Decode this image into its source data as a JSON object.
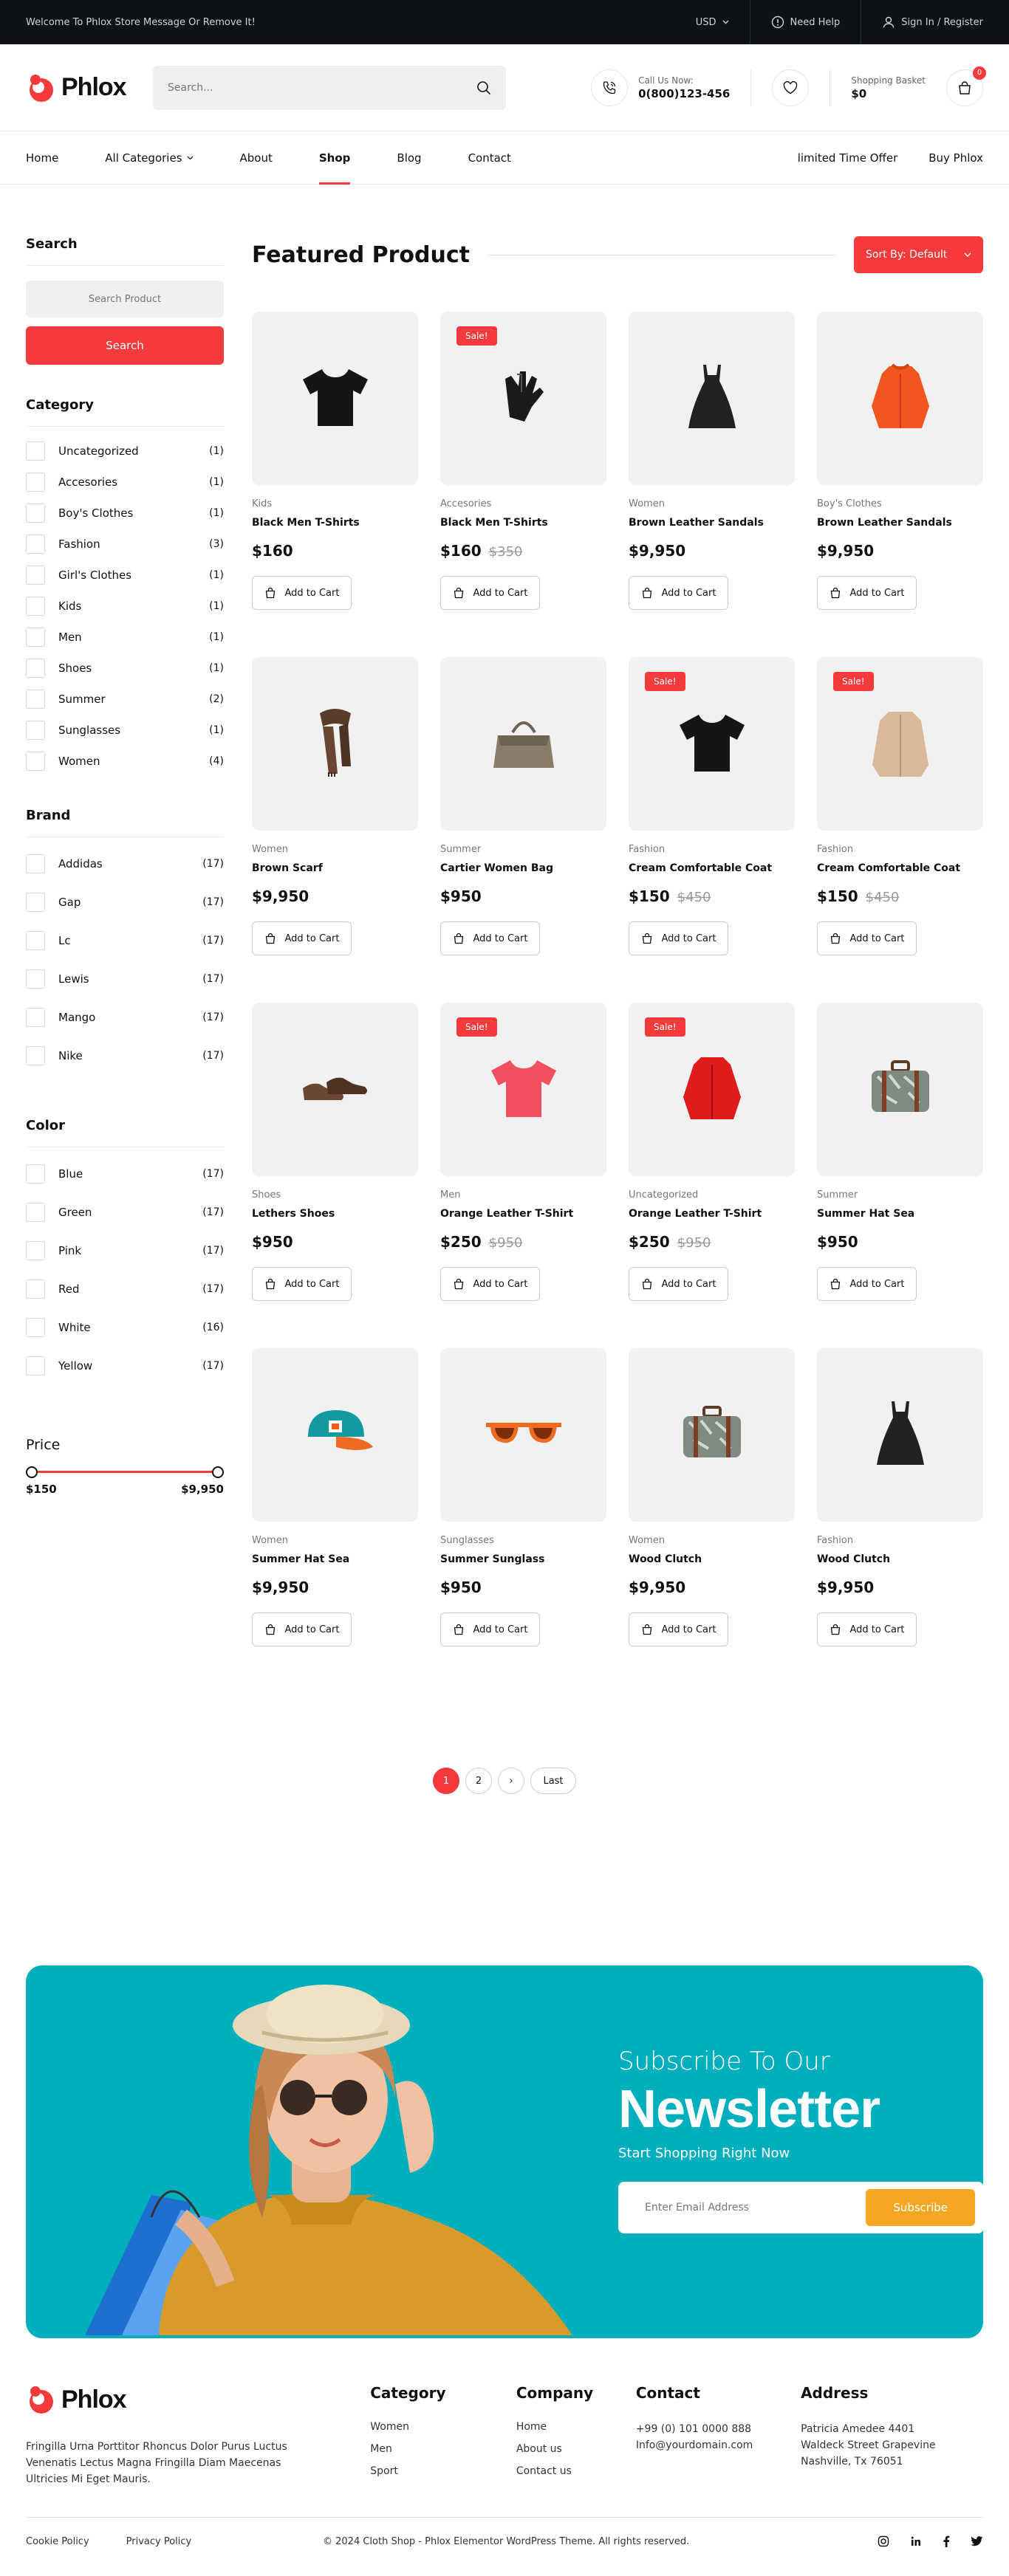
{
  "topbar": {
    "message": "Welcome To Phlox Store Message Or Remove It!",
    "currency": "USD",
    "help": "Need Help",
    "account": "Sign In / Register"
  },
  "header": {
    "logo": "Phlox",
    "search_placeholder": "Search...",
    "call_label": "Call Us Now:",
    "call_number": "0(800)123-456",
    "cart_label": "Shopping Basket",
    "cart_amount": "$0",
    "cart_count": "0"
  },
  "nav": {
    "items": [
      "Home",
      "All Categories",
      "About",
      "Shop",
      "Blog",
      "Contact"
    ],
    "right": [
      "limited Time Offer",
      "Buy Phlox"
    ]
  },
  "sidebar": {
    "search_title": "Search",
    "search_placeholder": "Search Product",
    "search_button": "Search",
    "category_title": "Category",
    "categories": [
      {
        "name": "Uncategorized",
        "count": "(1)"
      },
      {
        "name": "Accesories",
        "count": "(1)"
      },
      {
        "name": "Boy's Clothes",
        "count": "(1)"
      },
      {
        "name": "Fashion",
        "count": "(3)"
      },
      {
        "name": "Girl's Clothes",
        "count": "(1)"
      },
      {
        "name": "Kids",
        "count": "(1)"
      },
      {
        "name": "Men",
        "count": "(1)"
      },
      {
        "name": "Shoes",
        "count": "(1)"
      },
      {
        "name": "Summer",
        "count": "(2)"
      },
      {
        "name": "Sunglasses",
        "count": "(1)"
      },
      {
        "name": "Women",
        "count": "(4)"
      }
    ],
    "brand_title": "Brand",
    "brands": [
      {
        "name": "Addidas",
        "count": "(17)"
      },
      {
        "name": "Gap",
        "count": "(17)"
      },
      {
        "name": "Lc",
        "count": "(17)"
      },
      {
        "name": "Lewis",
        "count": "(17)"
      },
      {
        "name": "Mango",
        "count": "(17)"
      },
      {
        "name": "Nike",
        "count": "(17)"
      }
    ],
    "color_title": "Color",
    "colors": [
      {
        "name": "Blue",
        "count": "(17)"
      },
      {
        "name": "Green",
        "count": "(17)"
      },
      {
        "name": "Pink",
        "count": "(17)"
      },
      {
        "name": "Red",
        "count": "(17)"
      },
      {
        "name": "White",
        "count": "(16)"
      },
      {
        "name": "Yellow",
        "count": "(17)"
      }
    ],
    "price_title": "Price",
    "price_min": "$150",
    "price_max": "$9,950"
  },
  "content": {
    "title": "Featured Product",
    "sort_label": "Sort By: Default",
    "add_to_cart": "Add to Cart",
    "sale_label": "Sale!"
  },
  "products": [
    {
      "cat": "Kids",
      "name": "Black Men T-Shirts",
      "price": "$160",
      "old": "",
      "sale": false,
      "icon": "tshirt-black"
    },
    {
      "cat": "Accesories",
      "name": "Black Men T-Shirts",
      "price": "$160",
      "old": "$350",
      "sale": true,
      "icon": "gloves"
    },
    {
      "cat": "Women",
      "name": "Brown Leather Sandals",
      "price": "$9,950",
      "old": "",
      "sale": false,
      "icon": "dress"
    },
    {
      "cat": "Boy's Clothes",
      "name": "Brown Leather Sandals",
      "price": "$9,950",
      "old": "",
      "sale": false,
      "icon": "jacket-orange"
    },
    {
      "cat": "Women",
      "name": "Brown Scarf",
      "price": "$9,950",
      "old": "",
      "sale": false,
      "icon": "scarf"
    },
    {
      "cat": "Summer",
      "name": "Cartier Women Bag",
      "price": "$950",
      "old": "",
      "sale": false,
      "icon": "bag"
    },
    {
      "cat": "Fashion",
      "name": "Cream Comfortable Coat",
      "price": "$150",
      "old": "$450",
      "sale": true,
      "icon": "tshirt-black"
    },
    {
      "cat": "Fashion",
      "name": "Cream Comfortable Coat",
      "price": "$150",
      "old": "$450",
      "sale": true,
      "icon": "coat"
    },
    {
      "cat": "Shoes",
      "name": "Lethers Shoes",
      "price": "$950",
      "old": "",
      "sale": false,
      "icon": "shoes"
    },
    {
      "cat": "Men",
      "name": "Orange Leather T-Shirt",
      "price": "$250",
      "old": "$950",
      "sale": true,
      "icon": "tshirt-pink"
    },
    {
      "cat": "Uncategorized",
      "name": "Orange Leather T-Shirt",
      "price": "$250",
      "old": "$950",
      "sale": true,
      "icon": "jacket-red"
    },
    {
      "cat": "Summer",
      "name": "Summer Hat Sea",
      "price": "$950",
      "old": "",
      "sale": false,
      "icon": "suitcase"
    },
    {
      "cat": "Women",
      "name": "Summer Hat Sea",
      "price": "$9,950",
      "old": "",
      "sale": false,
      "icon": "cap"
    },
    {
      "cat": "Sunglasses",
      "name": "Summer Sunglass",
      "price": "$950",
      "old": "",
      "sale": false,
      "icon": "sunglasses"
    },
    {
      "cat": "Women",
      "name": "Wood Clutch",
      "price": "$9,950",
      "old": "",
      "sale": false,
      "icon": "suitcase"
    },
    {
      "cat": "Fashion",
      "name": "Wood Clutch",
      "price": "$9,950",
      "old": "",
      "sale": false,
      "icon": "dress"
    }
  ],
  "pagination": {
    "p1": "1",
    "p2": "2",
    "next": "›",
    "last": "Last"
  },
  "newsletter": {
    "line1": "Subscribe To Our",
    "line2": "Newsletter",
    "line3": "Start Shopping Right Now",
    "placeholder": "Enter Email Address",
    "button": "Subscribe"
  },
  "footer": {
    "logo": "Phlox",
    "about": "Fringilla Urna Porttitor Rhoncus Dolor Purus Luctus Venenatis Lectus Magna Fringilla Diam Maecenas Ultricies Mi Eget Mauris.",
    "category_title": "Category",
    "categories": [
      "Women",
      "Men",
      "Sport"
    ],
    "company_title": "Company",
    "company": [
      "Home",
      "About us",
      "Contact us"
    ],
    "contact_title": "Contact",
    "phone": "+99 (0) 101 0000 888",
    "email": "Info@yourdomain.com",
    "address_title": "Address",
    "address1": "Patricia Amedee 4401",
    "address2": "Waldeck Street Grapevine",
    "address3": "Nashville, Tx 76051"
  },
  "bottom": {
    "cookie": "Cookie Policy",
    "privacy": "Privacy Policy",
    "copyright": "© 2024 Cloth Shop - Phlox Elementor WordPress Theme. All rights reserved."
  },
  "colors": {
    "accent": "#f43a3a",
    "newsletter_bg": "#00afbd",
    "subscribe": "#f5a623",
    "topbar": "#0e1217"
  }
}
